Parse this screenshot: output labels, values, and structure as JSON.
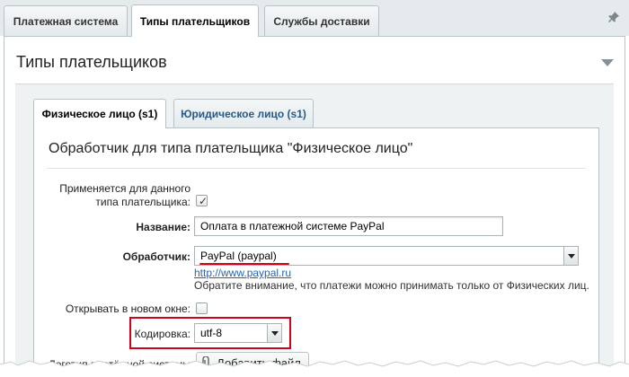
{
  "top_tabs": [
    {
      "label": "Платежная система",
      "active": false
    },
    {
      "label": "Типы плательщиков",
      "active": true
    },
    {
      "label": "Службы доставки",
      "active": false
    }
  ],
  "panel": {
    "title": "Типы плательщиков"
  },
  "sub_tabs": [
    {
      "label": "Физическое лицо (s1)",
      "active": true
    },
    {
      "label": "Юридическое лицо (s1)",
      "active": false
    }
  ],
  "section": {
    "title": "Обработчик для типа плательщика \"Физическое лицо\""
  },
  "form": {
    "applies_label_line1": "Применяется для данного",
    "applies_label_line2": "типа плательщика:",
    "applies_checked": true,
    "name_label": "Название:",
    "name_value": "Оплата в платежной системе PayPal",
    "handler_label": "Обработчик:",
    "handler_value": "PayPal (paypal)",
    "handler_link": "http://www.paypal.ru",
    "handler_note": "Обратите внимание, что платежи можно принимать только от Физических лиц.",
    "new_window_label": "Открывать в новом окне:",
    "new_window_checked": false,
    "encoding_label": "Кодировка:",
    "encoding_value": "utf-8",
    "logo_label": "Логотип платёжной системы",
    "add_file_label": "Добавить файл"
  },
  "colors": {
    "highlight": "#d0021b",
    "link": "#2a62b0",
    "tab_inactive_text": "#2a5a8a"
  }
}
